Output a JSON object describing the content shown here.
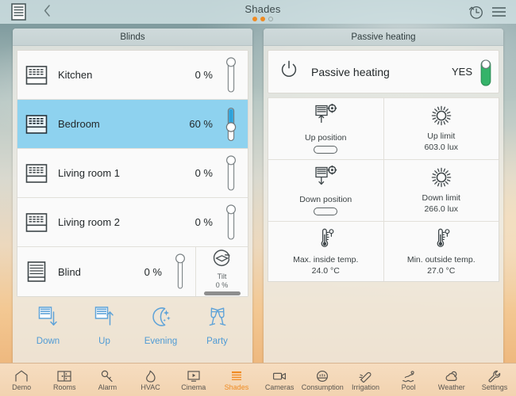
{
  "topbar": {
    "menu_icon": "blinds-icon",
    "back_icon": "chevron-left-icon",
    "title": "Shades",
    "dots": [
      "on",
      "on",
      "off"
    ],
    "history_icon": "history-clock-icon",
    "hamburger_icon": "hamburger-menu-icon"
  },
  "blinds_panel": {
    "title": "Blinds",
    "rows": [
      {
        "icon": "blind-slats-icon",
        "label": "Kitchen",
        "value": "0 %",
        "percent": 0,
        "selected": false,
        "tilt": null
      },
      {
        "icon": "blind-slats-icon",
        "label": "Bedroom",
        "value": "60 %",
        "percent": 60,
        "selected": true,
        "tilt": null
      },
      {
        "icon": "blind-slats-icon",
        "label": "Living room 1",
        "value": "0 %",
        "percent": 0,
        "selected": false,
        "tilt": null
      },
      {
        "icon": "blind-slats-icon",
        "label": "Living room 2",
        "value": "0 %",
        "percent": 0,
        "selected": false,
        "tilt": null
      },
      {
        "icon": "blind-solid-icon",
        "label": "Blind",
        "value": "0 %",
        "percent": 0,
        "selected": false,
        "tilt": {
          "icon": "tilt-rotate-icon",
          "label": "Tilt",
          "value": "0 %"
        }
      }
    ],
    "actions": [
      {
        "icon": "blind-down-icon",
        "label": "Down"
      },
      {
        "icon": "blind-up-icon",
        "label": "Up"
      },
      {
        "icon": "moon-stars-icon",
        "label": "Evening"
      },
      {
        "icon": "champagne-glasses-icon",
        "label": "Party"
      }
    ]
  },
  "heating_panel": {
    "title": "Passive heating",
    "switch_row": {
      "icon": "power-icon",
      "label": "Passive heating",
      "value": "YES",
      "toggle_on": true
    },
    "cells": [
      {
        "icon": "blind-up-gear-icon",
        "title": "Up position",
        "value": "",
        "has_pill": true
      },
      {
        "icon": "sun-icon",
        "title": "Up limit",
        "value": "603.0 lux",
        "has_pill": false
      },
      {
        "icon": "blind-down-gear-icon",
        "title": "Down position",
        "value": "",
        "has_pill": true
      },
      {
        "icon": "sun-icon",
        "title": "Down limit",
        "value": "266.0 lux",
        "has_pill": false
      },
      {
        "icon": "thermometer-icon",
        "title": "Max. inside temp.",
        "value": "24.0 °C",
        "has_pill": false
      },
      {
        "icon": "thermometer-icon",
        "title": "Min. outside temp.",
        "value": "27.0 °C",
        "has_pill": false
      }
    ]
  },
  "navbar": {
    "items": [
      {
        "icon": "house-icon",
        "label": "Demo",
        "active": false
      },
      {
        "icon": "rooms-grid-icon",
        "label": "Rooms",
        "active": false
      },
      {
        "icon": "key-icon",
        "label": "Alarm",
        "active": false
      },
      {
        "icon": "flame-icon",
        "label": "HVAC",
        "active": false
      },
      {
        "icon": "screen-play-icon",
        "label": "Cinema",
        "active": false
      },
      {
        "icon": "shades-icon",
        "label": "Shades",
        "active": true
      },
      {
        "icon": "camera-icon",
        "label": "Cameras",
        "active": false
      },
      {
        "icon": "gauge-icon",
        "label": "Consumption",
        "active": false
      },
      {
        "icon": "sprinkler-icon",
        "label": "Irrigation",
        "active": false
      },
      {
        "icon": "pool-icon",
        "label": "Pool",
        "active": false
      },
      {
        "icon": "cloud-sun-icon",
        "label": "Weather",
        "active": false
      },
      {
        "icon": "wrench-icon",
        "label": "Settings",
        "active": false
      }
    ]
  },
  "colors": {
    "accent_orange": "#ef8b22",
    "selected_blue": "#8ed2ef",
    "action_blue": "#4f9bd4",
    "toggle_green": "#35b36a"
  }
}
